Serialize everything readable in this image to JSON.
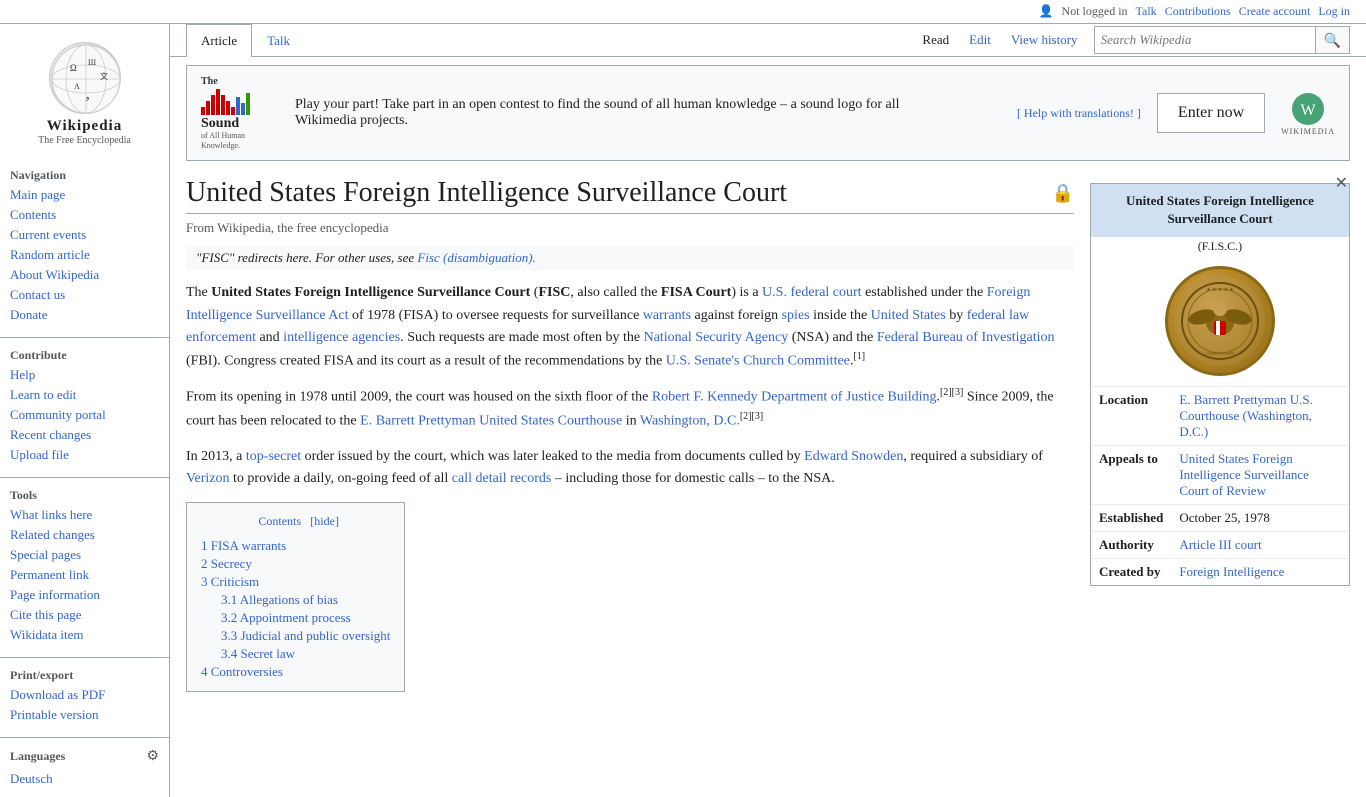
{
  "topbar": {
    "not_logged_in": "Not logged in",
    "talk": "Talk",
    "contributions": "Contributions",
    "create_account": "Create account",
    "log_in": "Log in"
  },
  "logo": {
    "title": "Wikipedia",
    "subtitle": "The Free Encyclopedia"
  },
  "sidebar": {
    "navigation_title": "Navigation",
    "items_nav": [
      {
        "label": "Main page",
        "id": "main-page"
      },
      {
        "label": "Contents",
        "id": "contents"
      },
      {
        "label": "Current events",
        "id": "current-events"
      },
      {
        "label": "Random article",
        "id": "random-article"
      },
      {
        "label": "About Wikipedia",
        "id": "about-wikipedia"
      },
      {
        "label": "Contact us",
        "id": "contact-us"
      },
      {
        "label": "Donate",
        "id": "donate"
      }
    ],
    "contribute_title": "Contribute",
    "items_contribute": [
      {
        "label": "Help",
        "id": "help"
      },
      {
        "label": "Learn to edit",
        "id": "learn-to-edit"
      },
      {
        "label": "Community portal",
        "id": "community-portal"
      },
      {
        "label": "Recent changes",
        "id": "recent-changes"
      },
      {
        "label": "Upload file",
        "id": "upload-file"
      }
    ],
    "tools_title": "Tools",
    "items_tools": [
      {
        "label": "What links here",
        "id": "what-links-here"
      },
      {
        "label": "Related changes",
        "id": "related-changes"
      },
      {
        "label": "Special pages",
        "id": "special-pages"
      },
      {
        "label": "Permanent link",
        "id": "permanent-link"
      },
      {
        "label": "Page information",
        "id": "page-information"
      },
      {
        "label": "Cite this page",
        "id": "cite-this-page"
      },
      {
        "label": "Wikidata item",
        "id": "wikidata-item"
      }
    ],
    "print_title": "Print/export",
    "items_print": [
      {
        "label": "Download as PDF",
        "id": "download-pdf"
      },
      {
        "label": "Printable version",
        "id": "printable-version"
      }
    ],
    "languages_title": "Languages",
    "language_items": [
      {
        "label": "Deutsch",
        "id": "deutsch"
      }
    ]
  },
  "tabs": {
    "article": "Article",
    "talk": "Talk",
    "read": "Read",
    "edit": "Edit",
    "view_history": "View history"
  },
  "search": {
    "placeholder": "Search Wikipedia"
  },
  "banner": {
    "help_translations": "[ Help with translations! ]",
    "sound_logo_alt": "The Sound of All Human Knowledge",
    "text": "Play your part! Take part in an open contest to find the sound of all human knowledge – a sound logo for all Wikimedia projects.",
    "enter_now": "Enter now",
    "wikimedia_label": "WIKIMEDIA"
  },
  "article": {
    "title": "United States Foreign Intelligence Surveillance Court",
    "from_wikipedia": "From Wikipedia, the free encyclopedia",
    "redirect_notice": "\"FISC\" redirects here. For other uses, see",
    "redirect_link": "Fisc (disambiguation).",
    "body_para1_prefix": "The ",
    "body_para1_bold": "United States Foreign Intelligence Surveillance Court",
    "body_para1_bold2": "FISC",
    "body_para1_bold3": "FISA Court",
    "body_para1_link1": "U.S. federal court",
    "body_para1_link2": "Foreign Intelligence Surveillance Act",
    "body_para1_link3": "warrants",
    "body_para1_link4": "spies",
    "body_para1_link5": "United States",
    "body_para1_link6": "federal law enforcement",
    "body_para1_link7": "intelligence agencies",
    "body_para1_link8": "National Security Agency",
    "body_para1_link9": "Federal Bureau of Investigation",
    "body_para1_link10": "U.S. Senate's Church Committee",
    "body_para2_link1": "Robert F. Kennedy Department of Justice Building",
    "body_para2_link2": "E. Barrett Prettyman United States Courthouse",
    "body_para2_link3": "Washington, D.C.",
    "body_para3_link1": "top-secret",
    "body_para3_link2": "Edward Snowden",
    "body_para3_link3": "Verizon",
    "body_para3_link4": "call detail records",
    "toc_title": "Contents",
    "toc_hide": "hide",
    "toc_items": [
      {
        "num": "1",
        "label": "FISA warrants",
        "level": 1
      },
      {
        "num": "2",
        "label": "Secrecy",
        "level": 1
      },
      {
        "num": "3",
        "label": "Criticism",
        "level": 1
      },
      {
        "num": "3.1",
        "label": "Allegations of bias",
        "level": 2
      },
      {
        "num": "3.2",
        "label": "Appointment process",
        "level": 2
      },
      {
        "num": "3.3",
        "label": "Judicial and public oversight",
        "level": 2
      },
      {
        "num": "3.4",
        "label": "Secret law",
        "level": 2
      },
      {
        "num": "4",
        "label": "Controversies",
        "level": 1
      }
    ]
  },
  "infobox": {
    "title": "United States Foreign Intelligence Surveillance Court",
    "subtitle": "(F.I.S.C.)",
    "rows": [
      {
        "label": "Location",
        "value": "E. Barrett Prettyman U.S. Courthouse (Washington, D.C.)",
        "is_link": true
      },
      {
        "label": "Appeals to",
        "value": "United States Foreign Intelligence Surveillance Court of Review",
        "is_link": true
      },
      {
        "label": "Established",
        "value": "October 25, 1978",
        "is_link": false
      },
      {
        "label": "Authority",
        "value": "Article III court",
        "is_link": true
      },
      {
        "label": "Created by",
        "value": "Foreign Intelligence",
        "is_link": true
      }
    ]
  }
}
